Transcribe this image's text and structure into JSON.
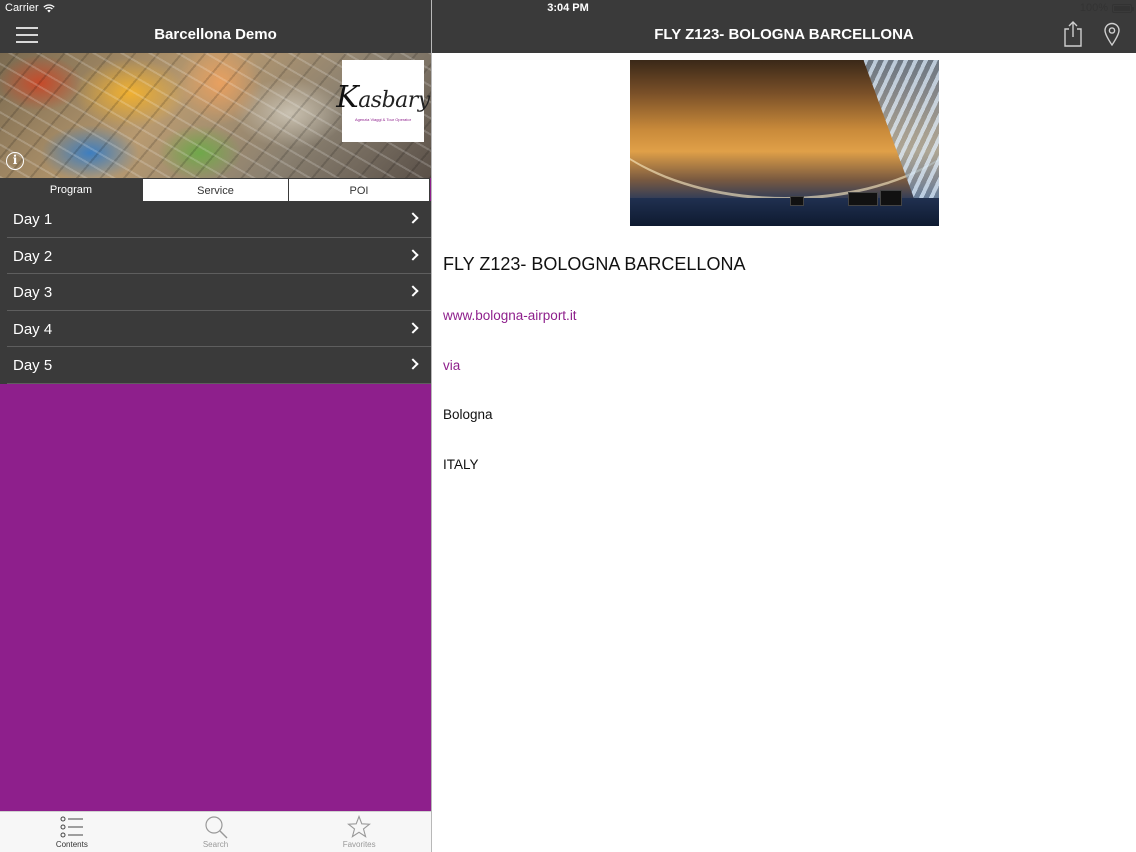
{
  "status_bar": {
    "carrier": "Carrier",
    "time": "3:04 PM",
    "battery": "100%",
    "battery_level": 1.0
  },
  "sidebar": {
    "title": "Barcellona Demo",
    "logo_text": "Kasbary",
    "logo_subtitle": "Agenzia Viaggi & Tour Operator",
    "segments": [
      {
        "label": "Program",
        "active": true
      },
      {
        "label": "Service",
        "active": false
      },
      {
        "label": "POI",
        "active": false
      }
    ],
    "items": [
      {
        "label": "Day 1"
      },
      {
        "label": "Day 2"
      },
      {
        "label": "Day 3"
      },
      {
        "label": "Day 4"
      },
      {
        "label": "Day 5"
      }
    ],
    "background_color": "#8e1f8c"
  },
  "tabbar": {
    "tabs": [
      {
        "label": "Contents",
        "icon": "list-icon",
        "active": true
      },
      {
        "label": "Search",
        "icon": "search-icon",
        "active": false
      },
      {
        "label": "Favorites",
        "icon": "star-icon",
        "active": false
      }
    ]
  },
  "detail": {
    "nav_title": "FLY Z123-  BOLOGNA BARCELLONA",
    "headline": "FLY Z123-  BOLOGNA BARCELLONA",
    "website": "www.bologna-airport.it",
    "address_link": "via",
    "city": "Bologna",
    "country": "ITALY",
    "link_color": "#8e1f8c"
  },
  "colors": {
    "nav_bar": "#3a3a3a",
    "accent": "#8e1f8c"
  }
}
